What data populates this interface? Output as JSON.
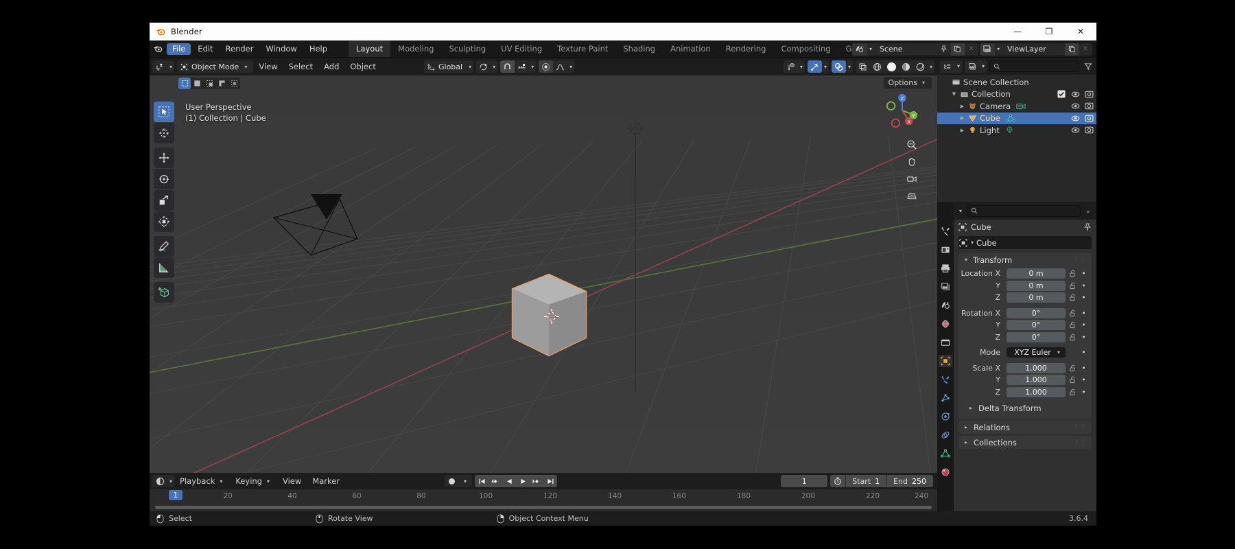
{
  "window": {
    "title": "Blender",
    "logo_icon": "blender-logo-icon",
    "minimize_label": "—",
    "maximize_label": "❐",
    "close_label": "✕"
  },
  "topbar": {
    "app_icon": "blender-icon",
    "menus": [
      {
        "label": "File",
        "active": true
      },
      {
        "label": "Edit",
        "active": false
      },
      {
        "label": "Render",
        "active": false
      },
      {
        "label": "Window",
        "active": false
      },
      {
        "label": "Help",
        "active": false
      }
    ],
    "workspace_tabs": [
      {
        "label": "Layout",
        "active": true
      },
      {
        "label": "Modeling",
        "active": false
      },
      {
        "label": "Sculpting",
        "active": false
      },
      {
        "label": "UV Editing",
        "active": false
      },
      {
        "label": "Texture Paint",
        "active": false
      },
      {
        "label": "Shading",
        "active": false
      },
      {
        "label": "Animation",
        "active": false
      },
      {
        "label": "Rendering",
        "active": false
      },
      {
        "label": "Compositing",
        "active": false
      },
      {
        "label": "Geometry Noc",
        "active": false
      }
    ],
    "scene": {
      "icon": "scene-icon",
      "name": "Scene",
      "pin_icon": "pin-icon",
      "copy_icon": "new-scene-icon",
      "unlink_icon": "unlink-icon"
    },
    "view_layer": {
      "icon": "view-layer-icon",
      "name": "ViewLayer",
      "copy_icon": "new-view-layer-icon",
      "remove_icon": "remove-view-layer-icon"
    }
  },
  "viewport": {
    "header": {
      "editor_type_icon": "editor-type-3dview-icon",
      "mode": "Object Mode",
      "mode_icon": "object-mode-icon",
      "menus": [
        "View",
        "Select",
        "Add",
        "Object"
      ],
      "transform_orientation": "Global",
      "orientation_icon": "orientation-icon",
      "pivot_icon": "pivot-point-icon",
      "snap_icon": "snap-magnet-icon",
      "snap_to_icon": "snap-increment-icon",
      "proportional_icon": "proportional-edit-icon",
      "falloff_icon": "proportional-falloff-icon",
      "visibility_icon": "object-types-visibility-icon",
      "gizmo_icon": "gizmo-icon",
      "overlays_icon": "overlays-icon",
      "xray_icon": "xray-toggle-icon",
      "shading_modes": [
        "wireframe-shading-icon",
        "solid-shading-icon",
        "material-preview-icon",
        "rendered-shading-icon"
      ],
      "shading_active_index": 1
    },
    "select_modes": [
      "select-box-icon",
      "select-set-icon",
      "select-extend-icon",
      "select-subtract-icon",
      "select-difference-icon"
    ],
    "select_mode_active_index": 0,
    "options_label": "Options",
    "overlay_line1": "User Perspective",
    "overlay_line2": "(1) Collection | Cube",
    "tools": [
      {
        "name": "tweak-select-box-tool",
        "active": true
      },
      {
        "name": "cursor-tool",
        "active": false
      },
      {
        "name": "move-tool",
        "active": false
      },
      {
        "name": "rotate-tool",
        "active": false
      },
      {
        "name": "scale-tool",
        "active": false
      },
      {
        "name": "transform-tool",
        "active": false
      },
      {
        "name": "annotate-tool",
        "active": false
      },
      {
        "name": "measure-tool",
        "active": false
      },
      {
        "name": "add-cube-tool",
        "active": false
      }
    ],
    "gizmo_axes": {
      "x": "X",
      "y": "Y",
      "z": "Z"
    },
    "nav_buttons": [
      "zoom-icon",
      "pan-hand-icon",
      "camera-view-icon",
      "toggle-perspective-icon"
    ],
    "objects": [
      "Cube",
      "Camera",
      "Light"
    ]
  },
  "timeline": {
    "editor_icon": "timeline-editor-icon",
    "menus": [
      "Playback",
      "Keying",
      "View",
      "Marker"
    ],
    "record_icon": "auto-keying-icon",
    "transport": [
      "jump-to-start-icon",
      "jump-to-prev-keyframe-icon",
      "play-reverse-icon",
      "play-icon",
      "jump-to-next-keyframe-icon",
      "jump-to-end-icon"
    ],
    "current_frame": "1",
    "clock_icon": "use-preview-range-icon",
    "start_label": "Start",
    "start_value": "1",
    "end_label": "End",
    "end_value": "250",
    "ticks": [
      "20",
      "40",
      "60",
      "80",
      "100",
      "120",
      "140",
      "160",
      "180",
      "200",
      "220",
      "240"
    ],
    "playhead_label": "1"
  },
  "outliner": {
    "display_mode_icon": "outliner-display-mode-icon",
    "scene_filter_icon": "outliner-view-layer-icon",
    "search_placeholder": "",
    "search_value": "",
    "search_icon": "search-icon",
    "filter_icon": "filter-funnel-icon",
    "rows": [
      {
        "label": "Scene Collection",
        "icon": "scene-collection-icon",
        "indent": 0,
        "has_tri": false,
        "tri": "",
        "selected": false,
        "checkbox": false,
        "hide_icon": false,
        "render_icon": false,
        "data_icon": ""
      },
      {
        "label": "Collection",
        "icon": "collection-icon",
        "indent": 1,
        "has_tri": true,
        "tri": "▼",
        "selected": false,
        "checkbox": true,
        "hide_icon": true,
        "render_icon": true,
        "data_icon": ""
      },
      {
        "label": "Camera",
        "icon": "camera-object-icon",
        "indent": 2,
        "has_tri": true,
        "tri": "▶",
        "selected": false,
        "checkbox": false,
        "hide_icon": true,
        "render_icon": true,
        "data_icon": "camera-data-icon"
      },
      {
        "label": "Cube",
        "icon": "mesh-object-icon",
        "indent": 2,
        "has_tri": true,
        "tri": "▶",
        "selected": true,
        "checkbox": false,
        "hide_icon": true,
        "render_icon": true,
        "data_icon": "mesh-data-icon"
      },
      {
        "label": "Light",
        "icon": "light-object-icon",
        "indent": 2,
        "has_tri": true,
        "tri": "▶",
        "selected": false,
        "checkbox": false,
        "hide_icon": true,
        "render_icon": true,
        "data_icon": "light-data-icon"
      }
    ]
  },
  "properties": {
    "editor_icon": "properties-editor-icon",
    "search_placeholder": "",
    "search_value": "",
    "search_icon": "search-icon",
    "options_chevron": "⌄",
    "tabs": [
      {
        "name": "tool-tab",
        "active": false
      },
      {
        "name": "render-tab",
        "active": false
      },
      {
        "name": "output-tab",
        "active": false
      },
      {
        "name": "view-layer-tab",
        "active": false
      },
      {
        "name": "scene-tab",
        "active": false
      },
      {
        "name": "world-tab",
        "active": false
      },
      {
        "name": "collection-tab",
        "active": false
      },
      {
        "name": "object-tab",
        "active": true
      },
      {
        "name": "modifiers-tab",
        "active": false
      },
      {
        "name": "particles-tab",
        "active": false
      },
      {
        "name": "physics-tab",
        "active": false
      },
      {
        "name": "constraints-tab",
        "active": false
      },
      {
        "name": "object-data-tab",
        "active": false
      },
      {
        "name": "material-tab",
        "active": false
      }
    ],
    "breadcrumb_icon": "object-icon",
    "breadcrumb": "Cube",
    "pin_icon": "pin-icon",
    "id_icon": "object-icon",
    "id_name": "Cube",
    "transform": {
      "title": "Transform",
      "open": true,
      "rows": [
        {
          "label": "Location X",
          "value": "0 m",
          "locked": false
        },
        {
          "label": "Y",
          "value": "0 m",
          "locked": false
        },
        {
          "label": "Z",
          "value": "0 m",
          "locked": false
        }
      ],
      "rotation_rows": [
        {
          "label": "Rotation X",
          "value": "0°",
          "locked": false
        },
        {
          "label": "Y",
          "value": "0°",
          "locked": false
        },
        {
          "label": "Z",
          "value": "0°",
          "locked": false
        }
      ],
      "mode_label": "Mode",
      "mode_value": "XYZ Euler",
      "scale_rows": [
        {
          "label": "Scale X",
          "value": "1.000",
          "locked": false
        },
        {
          "label": "Y",
          "value": "1.000",
          "locked": false
        },
        {
          "label": "Z",
          "value": "1.000",
          "locked": false
        }
      ],
      "delta_transform": "Delta Transform"
    },
    "panels": [
      {
        "label": "Relations",
        "open": false
      },
      {
        "label": "Collections",
        "open": false
      }
    ]
  },
  "status": {
    "items": [
      {
        "label": "Select",
        "icon": "mouse-left-icon"
      },
      {
        "label": "Rotate View",
        "icon": "mouse-middle-icon"
      },
      {
        "label": "Object Context Menu",
        "icon": "mouse-right-icon"
      }
    ],
    "version": "3.6.4"
  },
  "colors": {
    "accent": "#4772b3",
    "selected_object_outline": "#ed9e5c",
    "axis_x": "#c4566a",
    "axis_y": "#7bab3f",
    "panel_bg": "#303030",
    "header_bg": "#1d1d1d"
  }
}
